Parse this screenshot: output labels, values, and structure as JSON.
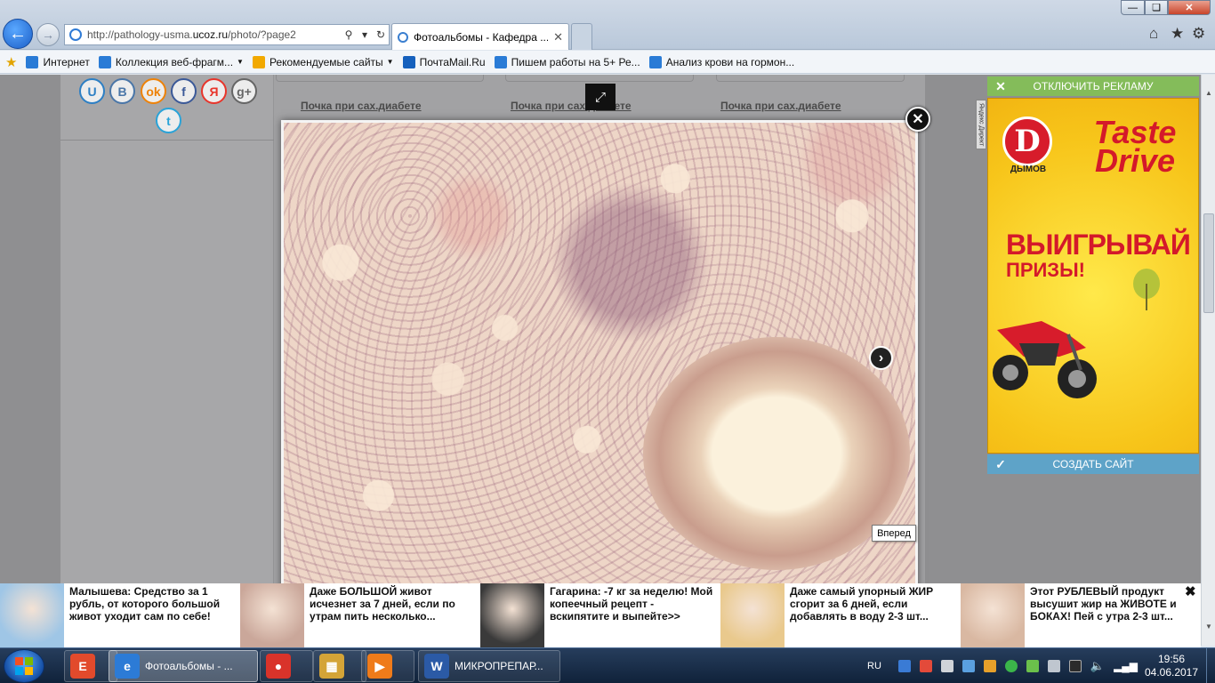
{
  "browser": {
    "address_url_prefix": "http://pathology-usma.",
    "address_url_domain": "ucoz.ru",
    "address_url_suffix": "/photo/?page2",
    "tab_title": "Фотоальбомы - Кафедра ...",
    "search_icon": "magnifier-icon",
    "refresh_icon": "refresh-icon"
  },
  "favorites": {
    "items": [
      {
        "label": "Интернет",
        "color": "#2a7bd6"
      },
      {
        "label": "Коллекция веб-фрагм...",
        "color": "#2a7bd6",
        "dropdown": true
      },
      {
        "label": "Рекомендуемые сайты",
        "color": "#f2a900",
        "dropdown": true
      },
      {
        "label": "ПочтаMail.Ru",
        "color": "#1560bd"
      },
      {
        "label": "Пишем работы на 5+  Ре...",
        "color": "#2a7bd6"
      },
      {
        "label": "Анализ крови на гормон...",
        "color": "#2a7bd6"
      }
    ]
  },
  "social": {
    "buttons": [
      {
        "label": "U",
        "color": "#2d7fc4"
      },
      {
        "label": "B",
        "color": "#4a76a8"
      },
      {
        "label": "ok",
        "color": "#ee8208"
      },
      {
        "label": "f",
        "color": "#3b5998"
      },
      {
        "label": "Я",
        "color": "#e8352b"
      },
      {
        "label": "g+",
        "color": "#666666"
      },
      {
        "label": "t",
        "color": "#2aa3d8"
      }
    ]
  },
  "photos": {
    "links": [
      "Почка при сах.диабете",
      "Почка при сах.диабете",
      "Почка при сах.диабете"
    ]
  },
  "lightbox": {
    "tooltip": "Вперед"
  },
  "ad": {
    "top_bar": "ОТКЛЮЧИТЬ РЕКЛАМУ",
    "bottom_bar": "СОЗДАТЬ САЙТ",
    "logo_letter": "D",
    "brand": "ДЫМОВ",
    "headline_1": "Taste",
    "headline_2": "Drive",
    "main": "ВЫИГРЫВАЙ",
    "sub": "ПРИЗЫ!",
    "corner": "Яндекс Директ"
  },
  "bottom_ads": [
    {
      "text": "Малышева: Средство за 1 рубль, от которого большой живот уходит сам по себе!",
      "color": "#9fc6e6"
    },
    {
      "text": "Даже БОЛЬШОЙ живот исчезнет за 7 дней, если по утрам пить несколько...",
      "color": "#caa79a"
    },
    {
      "text": "Гагарина: -7 кг за неделю! Мой копеечный рецепт - вскипятите и выпейте>>",
      "color": "#3a3a3a"
    },
    {
      "text": "Даже самый упорный ЖИР сгорит за 6 дней, если добавлять в воду 2-3 шт...",
      "color": "#e9c98d"
    },
    {
      "text": "Этот РУБЛЕВЫЙ продукт высушит жир на ЖИВОТЕ и БОКАХ! Пей с утра 2-3 шт...",
      "color": "#d9b8a2"
    }
  ],
  "taskbar": {
    "items": [
      {
        "label": "",
        "color": "#e24a2c",
        "icon": "E"
      },
      {
        "label": "Фотоальбомы - ...",
        "color": "#2c7bd6",
        "icon": "e",
        "active": true
      },
      {
        "label": "",
        "color": "#d9332a",
        "icon": "●"
      },
      {
        "label": "",
        "color": "#d4a437",
        "icon": "▦"
      },
      {
        "label": "",
        "color": "#ef7b1a",
        "icon": "▶"
      },
      {
        "label": "МИКРОПРЕПАР...",
        "color": "#2b5aa6",
        "icon": "W"
      }
    ],
    "language": "RU",
    "time": "19:56",
    "date": "04.06.2017"
  }
}
